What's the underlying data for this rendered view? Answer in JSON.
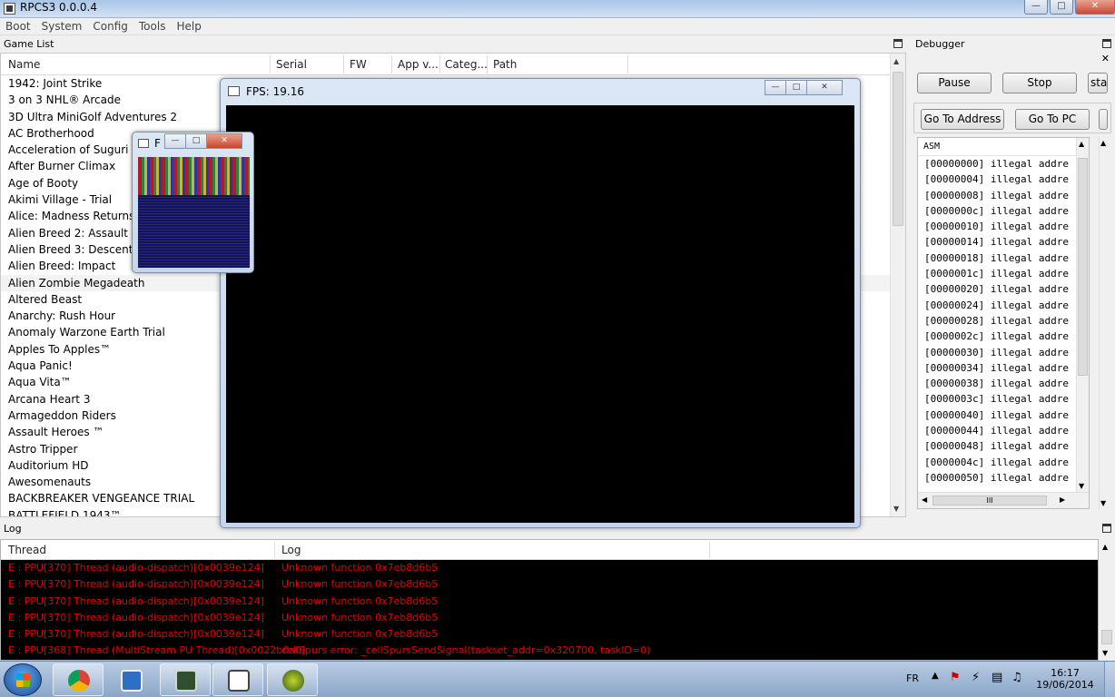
{
  "window": {
    "title": "RPCS3 0.0.0.4"
  },
  "menu": [
    "Boot",
    "System",
    "Config",
    "Tools",
    "Help"
  ],
  "gamelist": {
    "dock_title": "Game List",
    "columns": [
      "Name",
      "Serial",
      "FW",
      "App v...",
      "Categ...",
      "Path"
    ],
    "games": [
      "1942: Joint Strike",
      "3 on 3 NHL® Arcade",
      "3D Ultra MiniGolf Adventures 2",
      "AC Brotherhood",
      "Acceleration of Suguri X Ed",
      "After Burner Climax",
      "Age of Booty",
      "Akimi Village - Trial",
      "Alice: Madness Returns™ H",
      "Alien Breed 2: Assault",
      "Alien Breed 3: Descent DEM",
      "Alien Breed: Impact",
      "Alien Zombie Megadeath",
      "Altered Beast",
      "Anarchy: Rush Hour",
      "Anomaly Warzone Earth Trial",
      "Apples To Apples™",
      "Aqua Panic!",
      "Aqua Vita™",
      "Arcana Heart 3",
      "Armageddon Riders",
      "Assault Heroes ™",
      "Astro Tripper",
      "Auditorium HD",
      "Awesomenauts",
      "BACKBREAKER VENGEANCE TRIAL",
      "BATTLEFIELD 1943™"
    ]
  },
  "debugger": {
    "dock_title": "Debugger",
    "pause_label": "Pause",
    "stop_label": "Stop",
    "partial_label": "sta",
    "goto_address_label": "Go To Address",
    "goto_pc_label": "Go To PC",
    "asm_header": "ASM",
    "asm_lines": [
      "[00000000] illegal addre",
      "[00000004] illegal addre",
      "[00000008] illegal addre",
      "[0000000c] illegal addre",
      "[00000010] illegal addre",
      "[00000014] illegal addre",
      "[00000018] illegal addre",
      "[0000001c] illegal addre",
      "[00000020] illegal addre",
      "[00000024] illegal addre",
      "[00000028] illegal addre",
      "[0000002c] illegal addre",
      "[00000030] illegal addre",
      "[00000034] illegal addre",
      "[00000038] illegal addre",
      "[0000003c] illegal addre",
      "[00000040] illegal addre",
      "[00000044] illegal addre",
      "[00000048] illegal addre",
      "[0000004c] illegal addre",
      "[00000050] illegal addre"
    ],
    "hscroll_grip": "III"
  },
  "log": {
    "dock_title": "Log",
    "columns": [
      "Thread",
      "Log"
    ],
    "entries": [
      {
        "thread": "E : PPU[370] Thread (audio-dispatch)[0x0039e124]",
        "message": "Unknown function 0x7eb8d6b5"
      },
      {
        "thread": "E : PPU[370] Thread (audio-dispatch)[0x0039e124]",
        "message": "Unknown function 0x7eb8d6b5"
      },
      {
        "thread": "E : PPU[370] Thread (audio-dispatch)[0x0039e124]",
        "message": "Unknown function 0x7eb8d6b5"
      },
      {
        "thread": "E : PPU[370] Thread (audio-dispatch)[0x0039e124]",
        "message": "Unknown function 0x7eb8d6b5"
      },
      {
        "thread": "E : PPU[370] Thread (audio-dispatch)[0x0039e124]",
        "message": "Unknown function 0x7eb8d6b5"
      },
      {
        "thread": "E : PPU[368] Thread (MultiStream PU Thread)[0x0022b0a0]",
        "message": "cellSpurs error: _cellSpursSendSignal(taskset_addr=0x320700, taskID=0)"
      }
    ]
  },
  "fps_window": {
    "title": "FPS: 19.16"
  },
  "small_window": {
    "title": "F"
  },
  "taskbar": {
    "lang": "FR",
    "time": "16:17",
    "date": "19/06/2014",
    "apps": [
      "chrome-icon",
      "media-player-icon",
      "task-manager-icon",
      "window-icon",
      "app-icon"
    ]
  },
  "colors": {
    "log_error": "#e00000",
    "accent": "#1b4f94"
  }
}
